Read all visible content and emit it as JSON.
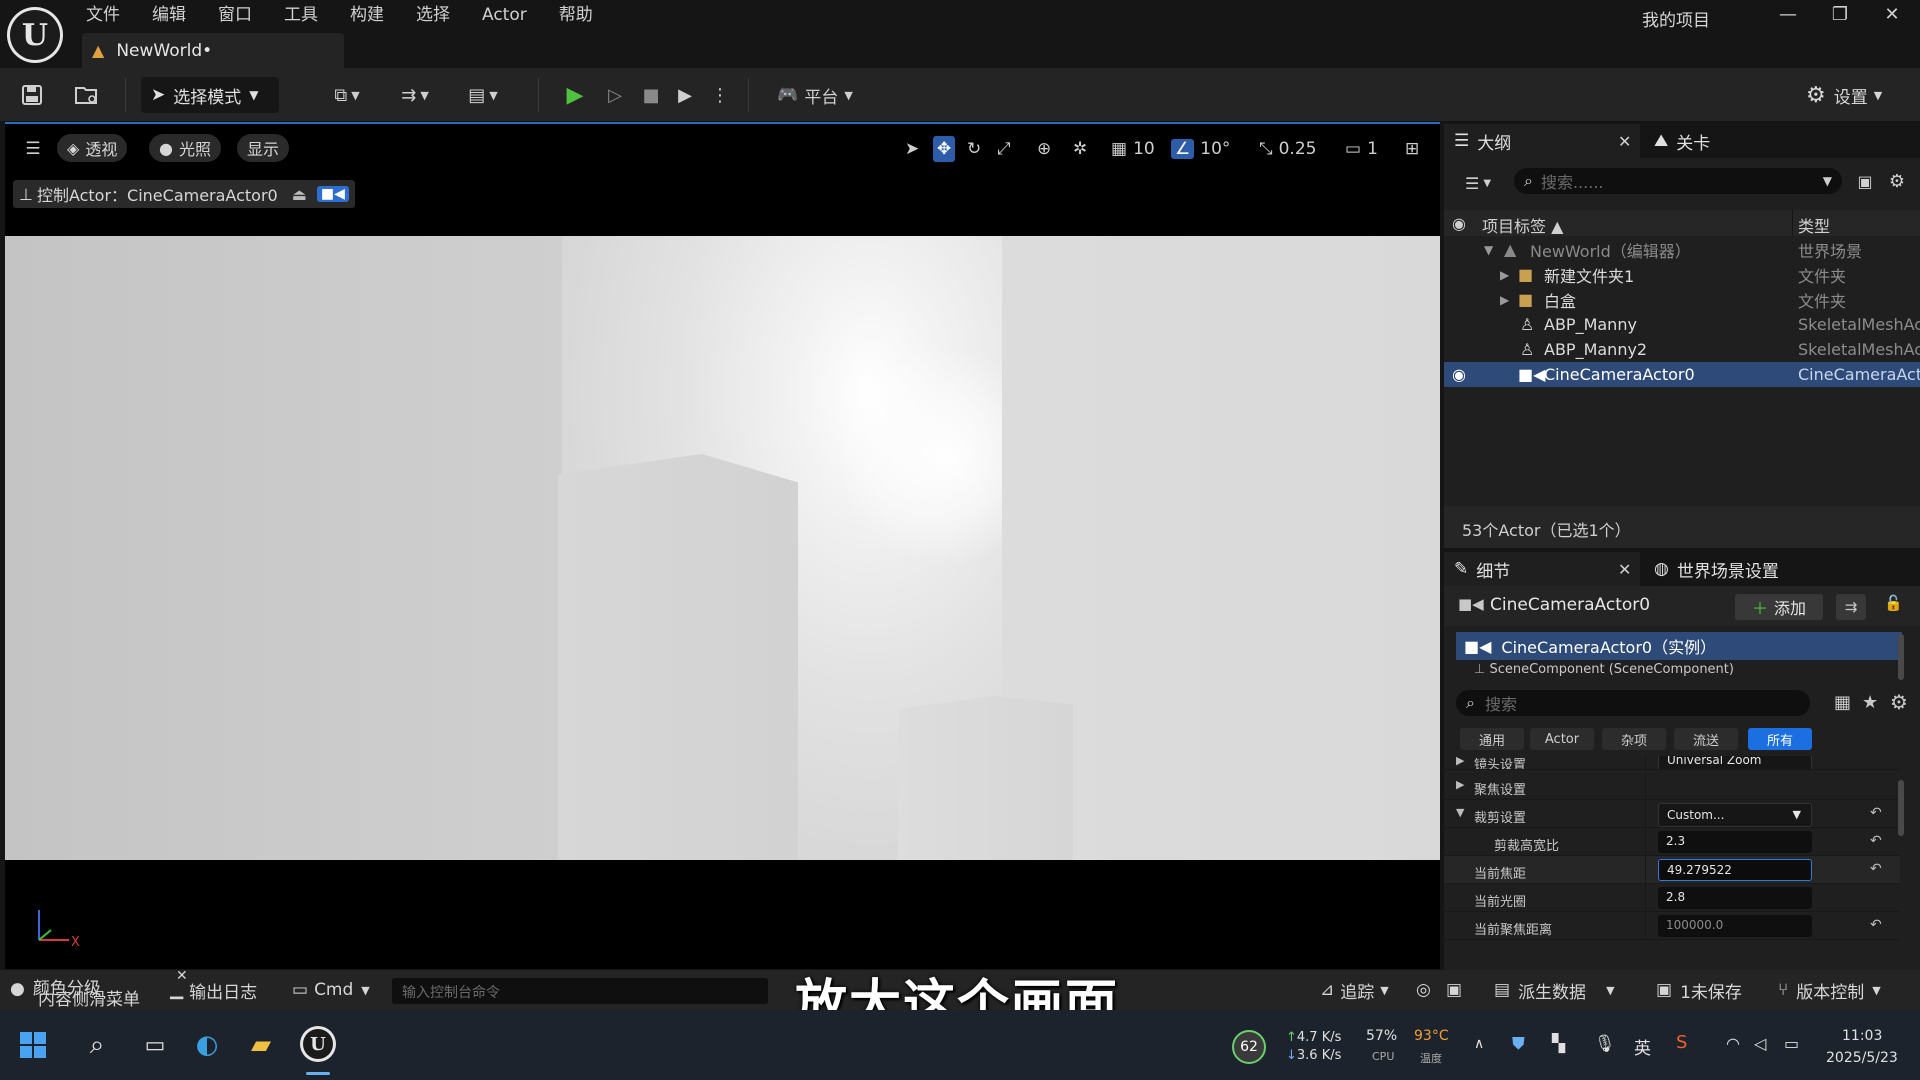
{
  "titlebar": {
    "menu": [
      "文件",
      "编辑",
      "窗口",
      "工具",
      "构建",
      "选择",
      "Actor",
      "帮助"
    ],
    "project_name": "我的项目",
    "doc_tab": "NewWorld•",
    "min": "—",
    "max": "❐",
    "close": "✕"
  },
  "toolbar": {
    "select_mode": "选择模式",
    "platform": "平台",
    "settings": "设置"
  },
  "viewport": {
    "perspective": "透视",
    "lighting": "光照",
    "show": "显示",
    "grid_size": "10",
    "rotation_snap": "10°",
    "scale_snap": "0.25",
    "camera_speed": "1",
    "pilot_label": "控制Actor：CineCameraActor0"
  },
  "outliner": {
    "tab_outliner": "大纲",
    "tab_levels": "关卡",
    "search_placeholder": "搜索......",
    "col_label": "项目标签 ▲",
    "col_type": "类型",
    "rows": [
      {
        "name": "NewWorld（编辑器）",
        "type": "世界场景"
      },
      {
        "name": "新建文件夹1",
        "type": "文件夹"
      },
      {
        "name": "白盒",
        "type": "文件夹"
      },
      {
        "name": "ABP_Manny",
        "type": "SkeletalMeshActor"
      },
      {
        "name": "ABP_Manny2",
        "type": "SkeletalMeshActor"
      },
      {
        "name": "CineCameraActor0",
        "type": "CineCameraActor"
      }
    ],
    "actor_count": "53个Actor（已选1个）"
  },
  "details": {
    "tab_details": "细节",
    "tab_world": "世界场景设置",
    "actor_name": "CineCameraActor0",
    "add_label": "添加",
    "instance": "CineCameraActor0（实例）",
    "component_row": "SceneComponent (SceneComponent)",
    "search_placeholder": "搜索",
    "filters": [
      "通用",
      "Actor",
      "杂项",
      "流送",
      "所有"
    ],
    "props": [
      {
        "label": "镜头设置",
        "value": "Universal Zoom"
      },
      {
        "label": "聚焦设置",
        "value": ""
      },
      {
        "label": "裁剪设置",
        "value": "Custom..."
      },
      {
        "label": "剪裁高宽比",
        "value": "2.3"
      },
      {
        "label": "当前焦距",
        "value": "49.279522"
      },
      {
        "label": "当前光圈",
        "value": "2.8"
      },
      {
        "label": "当前聚焦距离",
        "value": "100000.0"
      }
    ]
  },
  "bottombar": {
    "content_drawer": "内容侧滑菜单",
    "color_grading": "颜色分级",
    "output_log": "输出日志",
    "cmd": "Cmd",
    "console_placeholder": "输入控制台命令",
    "trace": "追踪",
    "derived_data": "派生数据",
    "unsaved": "1未保存",
    "source_control": "版本控制"
  },
  "subtitle": "放大这个画面",
  "taskbar": {
    "badge": "62",
    "net_up": "4.7 K/s",
    "net_down": "3.6 K/s",
    "cpu_value": "57%",
    "cpu_label": "CPU",
    "temp_value": "93°C",
    "temp_label": "温度",
    "ime": "英",
    "time": "11:03",
    "date": "2025/5/23"
  }
}
